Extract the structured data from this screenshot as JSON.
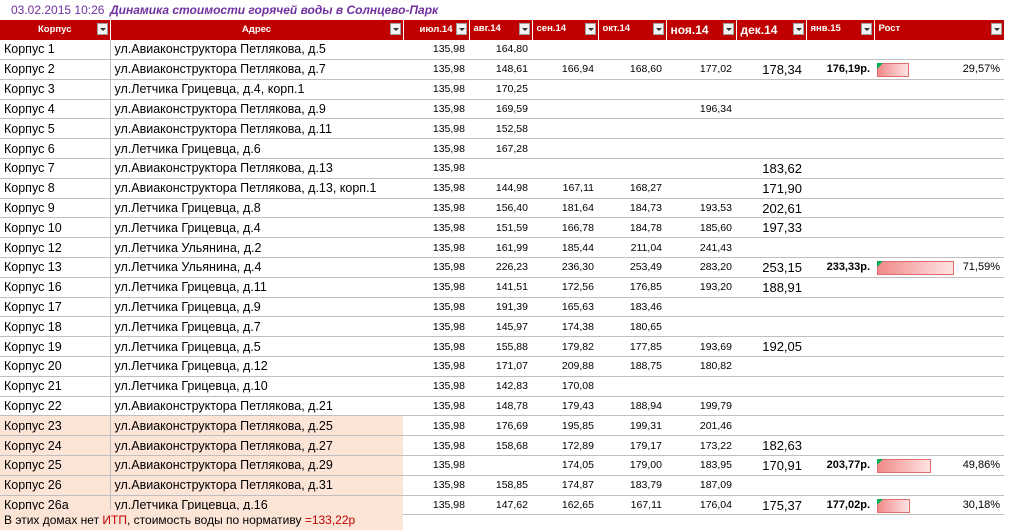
{
  "title": {
    "date": "03.02.2015 10:26",
    "text": "Динамика стоимости горячей воды в Солнцево-Парк"
  },
  "headers": [
    "Корпус",
    "Адрес",
    "июл.14",
    "авг.14",
    "сен.14",
    "окт.14",
    "ноя.14",
    "дек.14",
    "янв.15",
    "Рост"
  ],
  "rows": [
    {
      "korpus": "Корпус 1",
      "address": "ул.Авиаконструктора Петлякова, д.5",
      "jul": "135,98",
      "aug": "164,80",
      "sep": "",
      "oct": "",
      "nov": "",
      "dec": "",
      "jan": "",
      "growth": ""
    },
    {
      "korpus": "Корпус 2",
      "address": "ул.Авиаконструктора Петлякова, д.7",
      "jul": "135,98",
      "aug": "148,61",
      "sep": "166,94",
      "oct": "168,60",
      "nov": "177,02",
      "dec": "178,34",
      "jan": "176,19р.",
      "growth": "29,57%",
      "growth_fraction": 0.2957
    },
    {
      "korpus": "Корпус 3",
      "address": "ул.Летчика Грицевца, д.4, корп.1",
      "jul": "135,98",
      "aug": "170,25",
      "sep": "",
      "oct": "",
      "nov": "",
      "dec": "",
      "jan": "",
      "growth": ""
    },
    {
      "korpus": "Корпус 4",
      "address": "ул.Авиаконструктора Петлякова, д.9",
      "jul": "135,98",
      "aug": "169,59",
      "sep": "",
      "oct": "",
      "nov": "196,34",
      "dec": "",
      "jan": "",
      "growth": ""
    },
    {
      "korpus": "Корпус 5",
      "address": "ул.Авиаконструктора Петлякова, д.11",
      "jul": "135,98",
      "aug": "152,58",
      "sep": "",
      "oct": "",
      "nov": "",
      "dec": "",
      "jan": "",
      "growth": ""
    },
    {
      "korpus": "Корпус 6",
      "address": "ул.Летчика Грицевца, д.6",
      "jul": "135,98",
      "aug": "167,28",
      "sep": "",
      "oct": "",
      "nov": "",
      "dec": "",
      "jan": "",
      "growth": ""
    },
    {
      "korpus": "Корпус 7",
      "address": "ул.Авиаконструктора Петлякова, д.13",
      "jul": "135,98",
      "aug": "",
      "sep": "",
      "oct": "",
      "nov": "",
      "dec": "183,62",
      "jan": "",
      "growth": ""
    },
    {
      "korpus": "Корпус 8",
      "address": "ул.Авиаконструктора Петлякова, д.13, корп.1",
      "jul": "135,98",
      "aug": "144,98",
      "sep": "167,11",
      "oct": "168,27",
      "nov": "",
      "dec": "171,90",
      "jan": "",
      "growth": ""
    },
    {
      "korpus": "Корпус 9",
      "address": "ул.Летчика Грицевца, д.8",
      "jul": "135,98",
      "aug": "156,40",
      "sep": "181,64",
      "oct": "184,73",
      "nov": "193,53",
      "dec": "202,61",
      "jan": "",
      "growth": ""
    },
    {
      "korpus": "Корпус 10",
      "address": "ул.Летчика Грицевца, д.4",
      "jul": "135,98",
      "aug": "151,59",
      "sep": "166,78",
      "oct": "184,78",
      "nov": "185,60",
      "dec": "197,33",
      "jan": "",
      "growth": ""
    },
    {
      "korpus": "Корпус 12",
      "address": "ул.Летчика Ульянина, д.2",
      "jul": "135,98",
      "aug": "161,99",
      "sep": "185,44",
      "oct": "211,04",
      "nov": "241,43",
      "dec": "",
      "jan": "",
      "growth": ""
    },
    {
      "korpus": "Корпус 13",
      "address": "ул.Летчика Ульянина, д.4",
      "jul": "135,98",
      "aug": "226,23",
      "sep": "236,30",
      "oct": "253,49",
      "nov": "283,20",
      "dec": "253,15",
      "jan": "233,33р.",
      "growth": "71,59%",
      "growth_fraction": 0.7159
    },
    {
      "korpus": "Корпус 16",
      "address": "ул.Летчика Грицевца, д.11",
      "jul": "135,98",
      "aug": "141,51",
      "sep": "172,56",
      "oct": "176,85",
      "nov": "193,20",
      "dec": "188,91",
      "jan": "",
      "growth": ""
    },
    {
      "korpus": "Корпус 17",
      "address": "ул.Летчика Грицевца, д.9",
      "jul": "135,98",
      "aug": "191,39",
      "sep": "165,63",
      "oct": "183,46",
      "nov": "",
      "dec": "",
      "jan": "",
      "growth": ""
    },
    {
      "korpus": "Корпус 18",
      "address": "ул.Летчика Грицевца, д.7",
      "jul": "135,98",
      "aug": "145,97",
      "sep": "174,38",
      "oct": "180,65",
      "nov": "",
      "dec": "",
      "jan": "",
      "growth": ""
    },
    {
      "korpus": "Корпус 19",
      "address": "ул.Летчика Грицевца, д.5",
      "jul": "135,98",
      "aug": "155,88",
      "sep": "179,82",
      "oct": "177,85",
      "nov": "193,69",
      "dec": "192,05",
      "jan": "",
      "growth": ""
    },
    {
      "korpus": "Корпус 20",
      "address": "ул.Летчика Грицевца, д.12",
      "jul": "135,98",
      "aug": "171,07",
      "sep": "209,88",
      "oct": "188,75",
      "nov": "180,82",
      "dec": "",
      "jan": "",
      "growth": ""
    },
    {
      "korpus": "Корпус 21",
      "address": "ул.Летчика Грицевца, д.10",
      "jul": "135,98",
      "aug": "142,83",
      "sep": "170,08",
      "oct": "",
      "nov": "",
      "dec": "",
      "jan": "",
      "growth": ""
    },
    {
      "korpus": "Корпус 22",
      "address": "ул.Авиаконструктора Петлякова, д.21",
      "jul": "135,98",
      "aug": "148,78",
      "sep": "179,43",
      "oct": "188,94",
      "nov": "199,79",
      "dec": "",
      "jan": "",
      "growth": ""
    },
    {
      "korpus": "Корпус 23",
      "address": "ул.Авиаконструктора Петлякова, д.25",
      "jul": "135,98",
      "aug": "176,69",
      "sep": "195,85",
      "oct": "199,31",
      "nov": "201,46",
      "dec": "",
      "jan": "",
      "growth": "",
      "pink": true
    },
    {
      "korpus": "Корпус 24",
      "address": "ул.Авиаконструктора Петлякова, д.27",
      "jul": "135,98",
      "aug": "158,68",
      "sep": "172,89",
      "oct": "179,17",
      "nov": "173,22",
      "dec": "182,63",
      "jan": "",
      "growth": "",
      "pink": true
    },
    {
      "korpus": "Корпус 25",
      "address": "ул.Авиаконструктора Петлякова, д.29",
      "jul": "135,98",
      "aug": "",
      "sep": "174,05",
      "oct": "179,00",
      "nov": "183,95",
      "dec": "170,91",
      "jan": "203,77р.",
      "growth": "49,86%",
      "growth_fraction": 0.4986,
      "pink": true
    },
    {
      "korpus": "Корпус 26",
      "address": "ул.Авиаконструктора Петлякова, д.31",
      "jul": "135,98",
      "aug": "158,85",
      "sep": "174,87",
      "oct": "183,79",
      "nov": "187,09",
      "dec": "",
      "jan": "",
      "growth": "",
      "pink": true
    },
    {
      "korpus": "Корпус 26а",
      "address": "ул.Летчика Грицевца, д.16",
      "jul": "135,98",
      "aug": "147,62",
      "sep": "162,65",
      "oct": "167,11",
      "nov": "176,04",
      "dec": "175,37",
      "jan": "177,02р.",
      "growth": "30,18%",
      "growth_fraction": 0.3018,
      "pink": true
    }
  ],
  "footer": {
    "part1": "В этих домах нет ",
    "itp": "ИТП",
    "part2": ", стоимость воды по нормативу ",
    "value": "=133,22р"
  },
  "colors": {
    "header_bg": "#c00000",
    "title": "#7030a0",
    "pink": "#fce4d6",
    "bar": "#f28a8a"
  }
}
